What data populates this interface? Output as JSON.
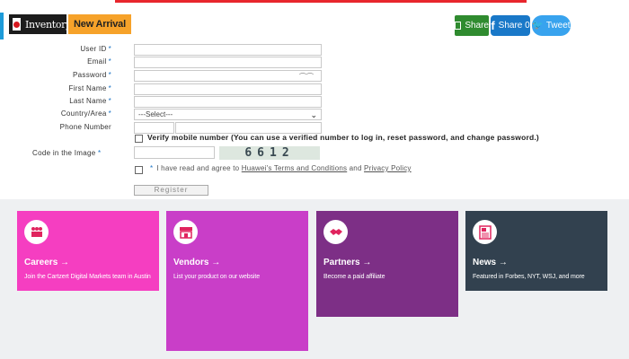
{
  "header": {
    "inventory_label": "Inventory",
    "new_arrival_label": "New Arrival",
    "share": {
      "email_label": "Share",
      "facebook_label": "Share 0",
      "twitter_label": "Tweet"
    }
  },
  "form": {
    "fields": [
      {
        "label": "User ID",
        "required": "*"
      },
      {
        "label": "Email",
        "required": "*"
      },
      {
        "label": "Password",
        "required": "*"
      },
      {
        "label": "First Name",
        "required": "*"
      },
      {
        "label": "Last Name",
        "required": "*"
      },
      {
        "label": "Country/Area",
        "required": "*",
        "value": "---Select---"
      },
      {
        "label": "Phone Number",
        "required": ""
      }
    ],
    "verify_text": "Verify mobile number (You can use a verified number to log in, reset password, and change password.)",
    "captcha_label": "Code in the Image",
    "captcha_required": "*",
    "captcha_text": "6612",
    "agree_required": "*",
    "agree_prefix": "I have read and agree to",
    "agree_link1": "Huawei's Terms and Conditions",
    "agree_and": "and",
    "agree_link2": "Privacy Policy",
    "register_label": "Register"
  },
  "cards": [
    {
      "title": "Careers",
      "arrow": "→",
      "desc": "Join the Cartzert Digital Markets team in Austin",
      "icon": "people-icon",
      "color": "#f53ec1"
    },
    {
      "title": "Vendors",
      "arrow": "→",
      "desc": "List your product on our website",
      "icon": "store-icon",
      "color": "#c93ec8"
    },
    {
      "title": "Partners",
      "arrow": "→",
      "desc": "Become a paid affiliate",
      "icon": "handshake-icon",
      "color": "#7d2f86"
    },
    {
      "title": "News",
      "arrow": "→",
      "desc": "Featured in Forbes, NYT, WSJ, and more",
      "icon": "newspaper-icon",
      "color": "#32414f"
    }
  ]
}
